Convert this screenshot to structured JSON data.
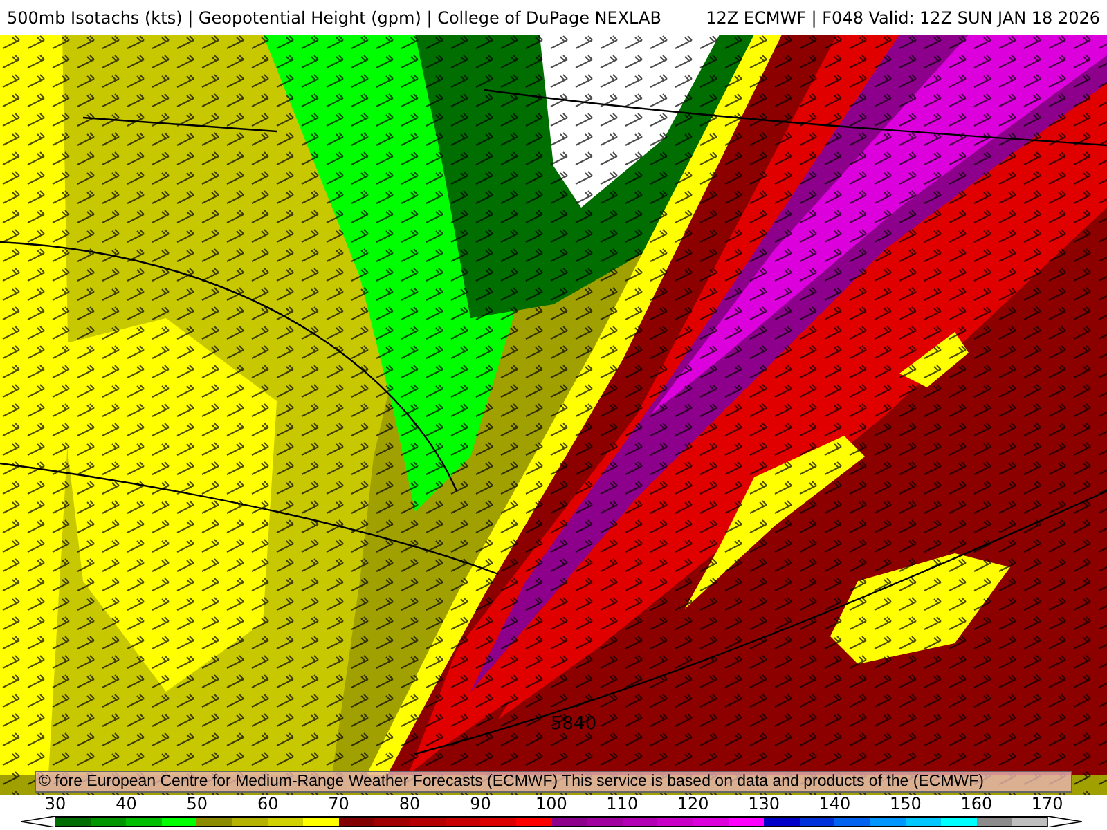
{
  "header": {
    "title": "500mb Isotachs (kts) | Geopotential Height (gpm) | College of DuPage NEXLAB",
    "valid": "12Z ECMWF | F048 Valid: 12Z SUN JAN 18 2026"
  },
  "map": {
    "contour_label": "5840",
    "attribution": "© fore European Centre for Medium-Range Weather Forecasts (ECMWF)  This service is based on data and products of the (ECMWF)"
  },
  "colorbar": {
    "labels": [
      "30",
      "40",
      "50",
      "60",
      "70",
      "80",
      "90",
      "100",
      "110",
      "120",
      "130",
      "140",
      "150",
      "160",
      "170"
    ],
    "swatches": [
      {
        "color": "#006e00"
      },
      {
        "color": "#009600"
      },
      {
        "color": "#00be00"
      },
      {
        "color": "#00ff00"
      },
      {
        "color": "#8c8c00"
      },
      {
        "color": "#b4b400"
      },
      {
        "color": "#d2d200"
      },
      {
        "color": "#ffff00"
      },
      {
        "color": "#820000"
      },
      {
        "color": "#a00000"
      },
      {
        "color": "#b40000"
      },
      {
        "color": "#c80000"
      },
      {
        "color": "#dc0000"
      },
      {
        "color": "#ff0000"
      },
      {
        "color": "#8c008c"
      },
      {
        "color": "#a000a0"
      },
      {
        "color": "#b400b4"
      },
      {
        "color": "#c800c8"
      },
      {
        "color": "#dc00dc"
      },
      {
        "color": "#ff00ff"
      },
      {
        "color": "#0000c8"
      },
      {
        "color": "#0032dc"
      },
      {
        "color": "#0064f0"
      },
      {
        "color": "#0096ff"
      },
      {
        "color": "#00c8ff"
      },
      {
        "color": "#00ffff"
      },
      {
        "color": "#8c8c8c"
      },
      {
        "color": "#bebebe"
      }
    ]
  }
}
